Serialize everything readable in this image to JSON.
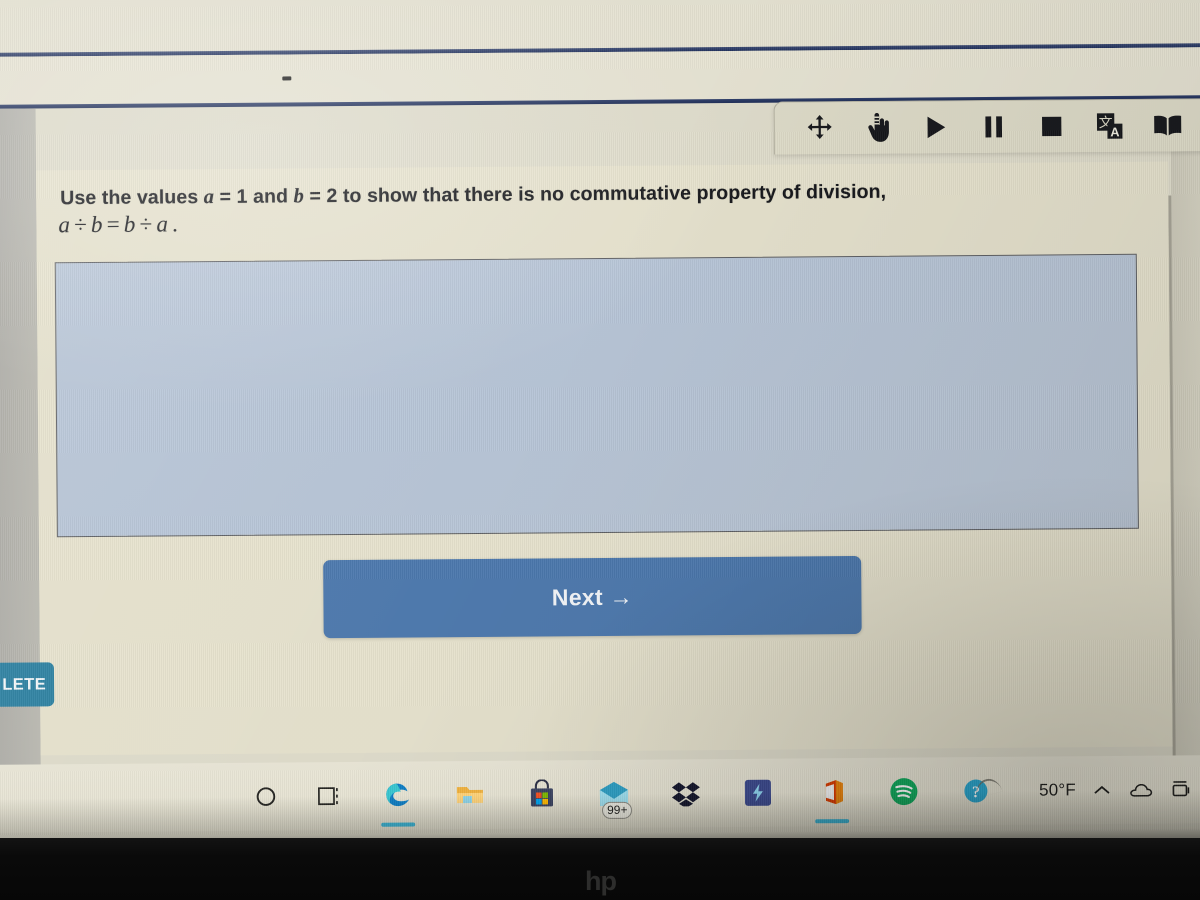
{
  "window": {
    "app_kind": "online-math-assignment",
    "background_color": "#e6e2cd",
    "accent_color": "#4c78ad"
  },
  "toolbar": {
    "buttons": [
      {
        "label": "Move",
        "icon": "move-arrows-icon"
      },
      {
        "label": "Pointer",
        "icon": "hand-pointer-icon"
      },
      {
        "label": "Play",
        "icon": "play-icon"
      },
      {
        "label": "Pause",
        "icon": "pause-icon"
      },
      {
        "label": "Stop",
        "icon": "stop-icon"
      },
      {
        "label": "Translate",
        "icon": "translate-icon"
      },
      {
        "label": "Glossary",
        "icon": "open-book-icon"
      }
    ]
  },
  "question": {
    "line1_part1": "Use the values ",
    "var_a": "a",
    "line1_part2": " = 1 and ",
    "var_b": "b",
    "line1_part3": " = 2 to show that there is no commutative property of division,",
    "formula": {
      "left_a": "a",
      "div1": "÷",
      "left_b": "b",
      "equals": "=",
      "right_b": "b",
      "div2": "÷",
      "right_a": "a",
      "period": "."
    }
  },
  "answer_box": {
    "value": "",
    "placeholder": "",
    "fill_color": "#b8c5d6"
  },
  "next_button": {
    "label": "Next →",
    "color": "#4c78ad"
  },
  "complete_button": {
    "label": "LETE",
    "color": "#2a7fa0"
  },
  "taskbar": {
    "icons": [
      {
        "name": "search-circle-icon",
        "label": "Search"
      },
      {
        "name": "task-view-icon",
        "label": "Task View"
      },
      {
        "name": "edge-browser-icon",
        "label": "Microsoft Edge"
      },
      {
        "name": "file-explorer-icon",
        "label": "File Explorer"
      },
      {
        "name": "microsoft-store-icon",
        "label": "Microsoft Store"
      },
      {
        "name": "mail-icon",
        "label": "Mail"
      },
      {
        "name": "dropbox-icon",
        "label": "Dropbox"
      },
      {
        "name": "blue-bolt-app-icon",
        "label": "App"
      },
      {
        "name": "office-icon",
        "label": "Office"
      },
      {
        "name": "spotify-icon",
        "label": "Spotify"
      },
      {
        "name": "help-question-icon",
        "label": "Help"
      }
    ],
    "mail_badge": "99+",
    "weather_temp": "50°F",
    "tray": [
      {
        "name": "chevron-up-icon",
        "label": "Show hidden icons"
      },
      {
        "name": "cloud-icon",
        "label": "OneDrive"
      },
      {
        "name": "network-icon",
        "label": "Network"
      }
    ]
  },
  "device": {
    "brand_logo": "hp"
  }
}
